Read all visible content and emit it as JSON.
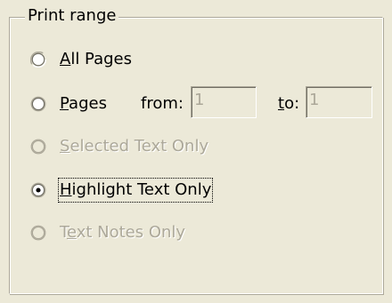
{
  "group": {
    "title": "Print range"
  },
  "options": {
    "all_pages": {
      "prefix": "",
      "underline": "A",
      "rest": "ll Pages"
    },
    "pages": {
      "prefix": "",
      "underline": "P",
      "rest": "ages"
    },
    "selected_text": {
      "prefix": "",
      "underline": "S",
      "rest": "elected Text Only"
    },
    "highlight_text": {
      "prefix": "",
      "underline": "H",
      "rest": "ighlight Text Only"
    },
    "text_notes": {
      "prefix": "T",
      "underline": "e",
      "rest": "xt Notes Only"
    }
  },
  "range": {
    "from_label": "from:",
    "from_value": "1",
    "to_label_underline": "t",
    "to_label_rest": "o:",
    "to_value": "1"
  },
  "state": {
    "selected_option": "Highlight Text Only",
    "disabled_options": [
      "Selected Text Only",
      "Text Notes Only"
    ],
    "range_fields_enabled": false
  },
  "colors": {
    "dialog_background": "#ECE9D8",
    "disabled_text": "#ACA899",
    "frame_shadow": "#ACA899",
    "frame_highlight": "#FFFFFF"
  }
}
